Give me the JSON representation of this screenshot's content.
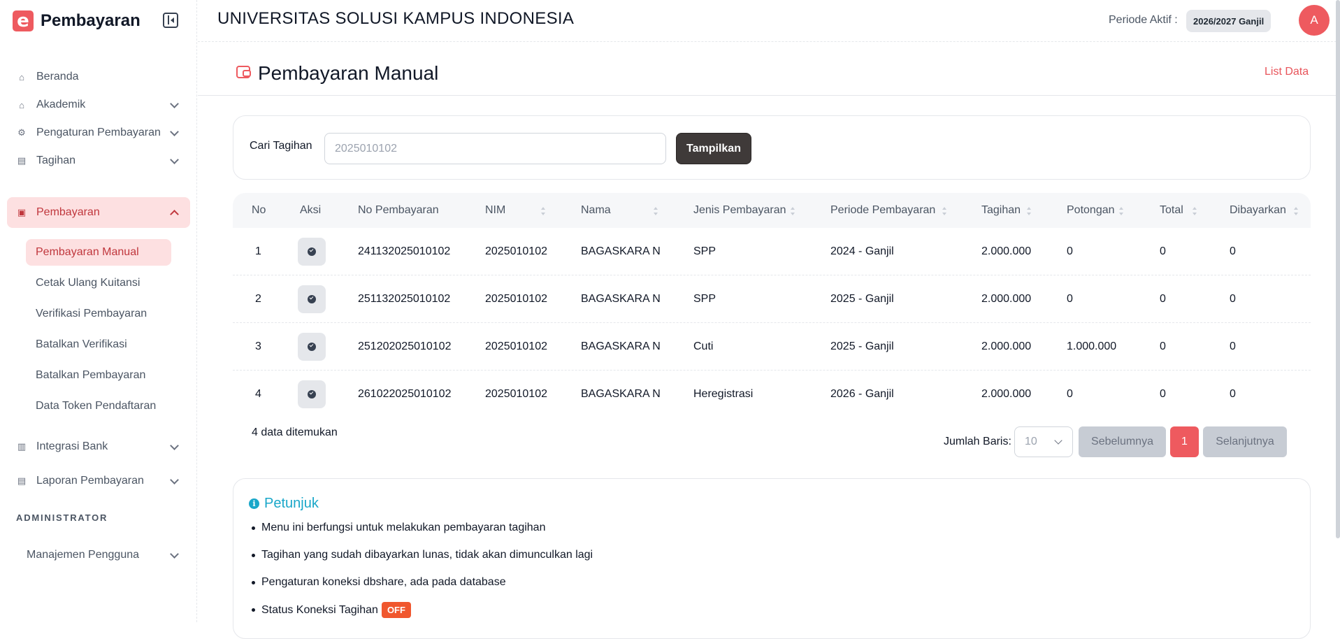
{
  "brand": {
    "logo_letter": "e",
    "title": "Pembayaran"
  },
  "sidebar": {
    "items": [
      {
        "label": "Beranda",
        "icon": "home-icon"
      },
      {
        "label": "Akademik",
        "icon": "graduation-cap-icon"
      },
      {
        "label": "Pengaturan Pembayaran",
        "icon": "settings-icon"
      },
      {
        "label": "Tagihan",
        "icon": "clipboard-icon"
      },
      {
        "label": "Pembayaran",
        "icon": "wallet-icon"
      },
      {
        "label": "Integrasi Bank",
        "icon": "bank-icon"
      },
      {
        "label": "Laporan Pembayaran",
        "icon": "report-icon"
      }
    ],
    "subitems": [
      {
        "label": "Pembayaran Manual"
      },
      {
        "label": "Cetak Ulang Kuitansi"
      },
      {
        "label": "Verifikasi Pembayaran"
      },
      {
        "label": "Batalkan Verifikasi"
      },
      {
        "label": "Batalkan Pembayaran"
      },
      {
        "label": "Data Token Pendaftaran"
      }
    ],
    "section_label": "ADMINISTRATOR",
    "admin_item": "Manajemen Pengguna"
  },
  "header": {
    "university": "UNIVERSITAS SOLUSI KAMPUS INDONESIA",
    "periode_label": "Periode Aktif :",
    "periode_value": "2026/2027 Ganjil",
    "avatar_letter": "A"
  },
  "page": {
    "title": "Pembayaran Manual",
    "list_link": "List Data"
  },
  "search": {
    "label": "Cari Tagihan",
    "value": "2025010102",
    "button": "Tampilkan"
  },
  "table": {
    "headers": [
      "No",
      "Aksi",
      "No Pembayaran",
      "NIM",
      "Nama",
      "Jenis Pembayaran",
      "Periode Pembayaran",
      "Tagihan",
      "Potongan",
      "Total",
      "Dibayarkan"
    ],
    "rows": [
      {
        "no": "1",
        "no_pembayaran": "241132025010102",
        "nim": "2025010102",
        "nama": "BAGASKARA N",
        "jenis": "SPP",
        "periode": "2024 - Ganjil",
        "tagihan": "2.000.000",
        "potongan": "0",
        "total": "0",
        "dibayarkan": "0"
      },
      {
        "no": "2",
        "no_pembayaran": "251132025010102",
        "nim": "2025010102",
        "nama": "BAGASKARA N",
        "jenis": "SPP",
        "periode": "2025 - Ganjil",
        "tagihan": "2.000.000",
        "potongan": "0",
        "total": "0",
        "dibayarkan": "0"
      },
      {
        "no": "3",
        "no_pembayaran": "251202025010102",
        "nim": "2025010102",
        "nama": "BAGASKARA N",
        "jenis": "Cuti",
        "periode": "2025 - Ganjil",
        "tagihan": "2.000.000",
        "potongan": "1.000.000",
        "total": "0",
        "dibayarkan": "0"
      },
      {
        "no": "4",
        "no_pembayaran": "261022025010102",
        "nim": "2025010102",
        "nama": "BAGASKARA N",
        "jenis": "Heregistrasi",
        "periode": "2026 - Ganjil",
        "tagihan": "2.000.000",
        "potongan": "0",
        "total": "0",
        "dibayarkan": "0"
      }
    ],
    "found_text": "4 data ditemukan",
    "rows_label": "Jumlah Baris:",
    "rows_value": "10",
    "prev": "Sebelumnya",
    "page": "1",
    "next": "Selanjutnya"
  },
  "info": {
    "title": "Petunjuk",
    "items": [
      "Menu ini berfungsi untuk melakukan pembayaran tagihan",
      "Tagihan yang sudah dibayarkan lunas, tidak akan dimunculkan lagi",
      "Pengaturan koneksi dbshare, ada pada database",
      "Status Koneksi Tagihan"
    ],
    "status_badge": "OFF"
  },
  "colors": {
    "accent": "#ee5a5f",
    "info": "#1aa7c9",
    "off": "#f0572e"
  }
}
